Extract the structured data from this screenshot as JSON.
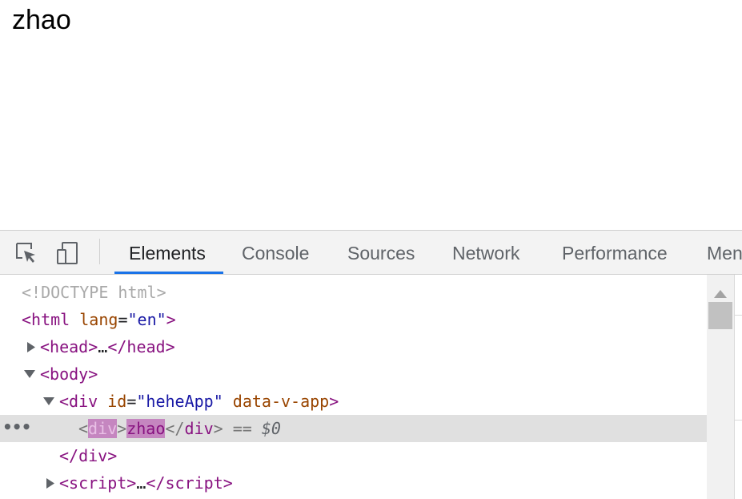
{
  "page": {
    "text": "zhao"
  },
  "devtools": {
    "toolbar": {
      "inspect_icon": "inspect-element-icon",
      "device_icon": "device-toggle-icon",
      "tabs": [
        {
          "label": "Elements",
          "active": true
        },
        {
          "label": "Console",
          "active": false
        },
        {
          "label": "Sources",
          "active": false
        },
        {
          "label": "Network",
          "active": false
        },
        {
          "label": "Performance",
          "active": false
        },
        {
          "label": "Men",
          "active": false
        }
      ],
      "accent": "#1a73e8"
    },
    "dom": {
      "doctype": "<!DOCTYPE html>",
      "html": {
        "tag": "html",
        "attr": "lang",
        "val": "en"
      },
      "head": {
        "open": "head",
        "ellipsis": "…",
        "close": "head"
      },
      "body": {
        "tag": "body"
      },
      "div": {
        "tag": "div",
        "attr1": "id",
        "val1": "heheApp",
        "attr2": "data-v-app"
      },
      "selected": {
        "tag": "div",
        "text": "zhao",
        "close": "div",
        "marker": "==",
        "ref": "$0",
        "dots": "•••"
      },
      "div_close": {
        "tag": "div"
      },
      "script": {
        "open": "script",
        "ellipsis": "…",
        "close": "script"
      }
    }
  }
}
